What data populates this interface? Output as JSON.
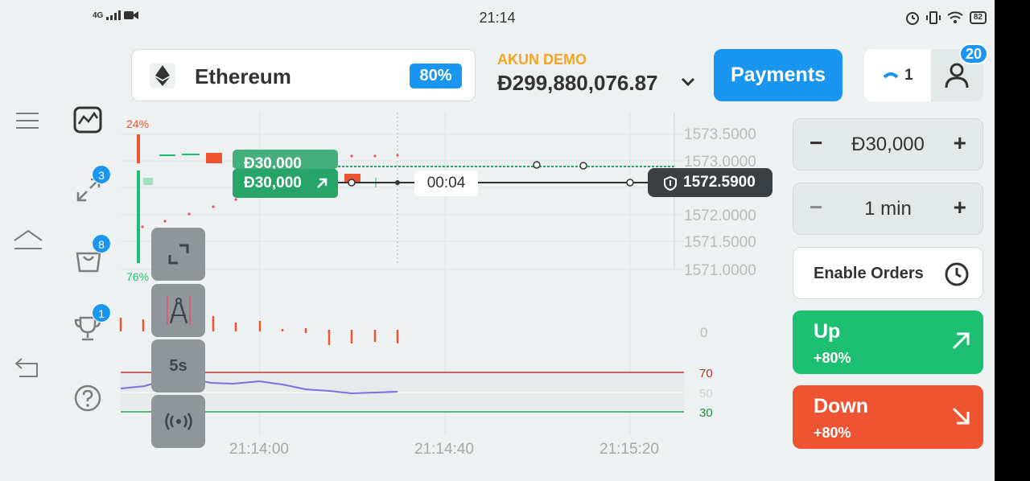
{
  "status_bar": {
    "network": "4G",
    "time": "21:14",
    "battery": "82"
  },
  "asset": {
    "name": "Ethereum",
    "payout": "80%",
    "icon": "ethereum-icon"
  },
  "account": {
    "label": "AKUN DEMO",
    "balance": "Đ299,880,076.87"
  },
  "payments_label": "Payments",
  "profile": {
    "open_trades": "1",
    "notifications": "20"
  },
  "sidebar_badges": {
    "trades": "3",
    "market": "8",
    "tournaments": "1"
  },
  "chart": {
    "y_ticks": [
      "1573.5000",
      "1573.0000",
      "1572.0000",
      "1571.5000",
      "1571.0000"
    ],
    "x_ticks": [
      "21:14:00",
      "21:14:40",
      "21:15:20"
    ],
    "sentiment_down": "24%",
    "sentiment_up": "76%",
    "orders": [
      "Đ30,000",
      "Đ30,000"
    ],
    "countdown": "00:04",
    "current_price": "1572.5900",
    "macd_zero": "0",
    "rsi_levels": [
      "70",
      "50",
      "30"
    ],
    "timeframe_tool": "5s"
  },
  "controls": {
    "amount": "Đ30,000",
    "duration": "1 min",
    "minus": "−",
    "plus": "+",
    "enable_orders": "Enable Orders"
  },
  "trade": {
    "up_label": "Up",
    "up_payout": "+80%",
    "down_label": "Down",
    "down_payout": "+80%"
  },
  "colors": {
    "accent": "#1a96f0",
    "up": "#1dbf73",
    "down": "#ee5432",
    "demo": "#f2a621"
  }
}
